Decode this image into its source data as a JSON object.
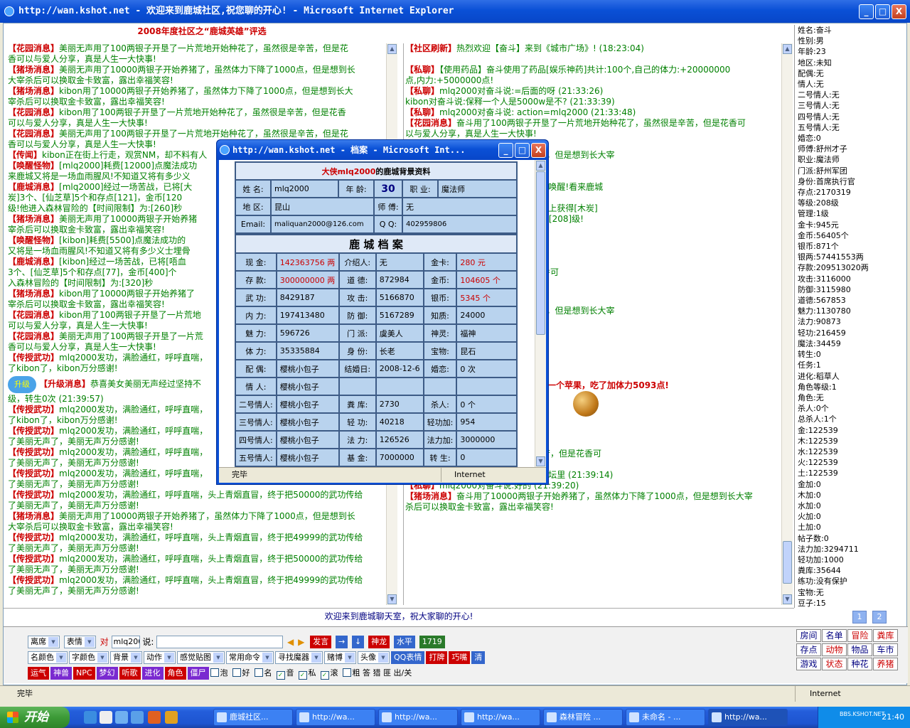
{
  "window": {
    "title": "http://wan.kshot.net - 欢迎来到鹿城社区,祝您聊的开心! - Microsoft Internet Explorer",
    "min": "_",
    "max": "□",
    "close": "X"
  },
  "banner": "2008年度社区之“鹿城英雄”评选",
  "left_chat": [
    {
      "tag": "【花园消息】",
      "text": "美丽无声用了100两银子开垦了一片荒地开始种花了，虽然很是辛苦，但是花"
    },
    {
      "tag": "",
      "text": "香可以与爱人分享，真是人生一大快事!"
    },
    {
      "tag": "【猪场消息】",
      "text": "美丽无声用了10000两银子开始养猪了，虽然体力下降了1000点，但是想到长"
    },
    {
      "tag": "",
      "text": "大宰杀后可以换取金卡致富，露出幸福笑容!"
    },
    {
      "tag": "【猪场消息】",
      "text": "kibon用了10000两银子开始养猪了，虽然体力下降了1000点，但是想到长大"
    },
    {
      "tag": "",
      "text": "宰杀后可以换取金卡致富，露出幸福笑容!"
    },
    {
      "tag": "【花园消息】",
      "text": "kibon用了100两银子开垦了一片荒地开始种花了，虽然很是辛苦，但是花香"
    },
    {
      "tag": "",
      "text": "可以与爱人分享，真是人生一大快事!"
    },
    {
      "tag": "【花园消息】",
      "text": "美丽无声用了100两银子开垦了一片荒地开始种花了，虽然很是辛苦，但是花"
    },
    {
      "tag": "",
      "text": "香可以与爱人分享，真是人生一大快事!"
    },
    {
      "tag": "【传闻】",
      "text": "kibon正在街上行走，观赏NM，却不料有人"
    },
    {
      "tag": "【唤醒怪物】",
      "text": "[mlq2000]耗费[12000]点魔法成功"
    },
    {
      "tag": "",
      "text": "来鹿城又将是一场血雨腥风!不知道又将有多少义"
    },
    {
      "tag": "【鹿城消息】",
      "text": "[mlq2000]经过一场苦战，已将[大"
    },
    {
      "tag": "",
      "text": "炭]3个、[仙芝草]5个和存点[121]，金币[120"
    },
    {
      "tag": "",
      "text": "级!他进入森林冒险的【时间限制】为:[260]秒"
    },
    {
      "tag": "【猪场消息】",
      "text": "美丽无声用了10000两银子开始养猪"
    },
    {
      "tag": "",
      "text": "宰杀后可以换取金卡致富，露出幸福笑容!"
    },
    {
      "tag": "【唤醒怪物】",
      "text": "[kibon]耗费[5500]点魔法成功的"
    },
    {
      "tag": "",
      "text": "又将是一场血雨腥风!不知道又将有多少义士埋骨"
    },
    {
      "tag": "【鹿城消息】",
      "text": "[kibon]经过一场苦战，已将[唔血"
    },
    {
      "tag": "",
      "text": "3个、[仙芝草]5个和存点[77]，金币[400]个"
    },
    {
      "tag": "",
      "text": "入森林冒险的【时间限制】为:[320]秒"
    },
    {
      "tag": "【猪场消息】",
      "text": "kibon用了10000两银子开始养猪了"
    },
    {
      "tag": "",
      "text": "宰杀后可以换取金卡致富，露出幸福笑容!"
    },
    {
      "tag": "【花园消息】",
      "text": "kibon用了100两银子开垦了一片荒地"
    },
    {
      "tag": "",
      "text": "可以与爱人分享，真是人生一大快事!"
    },
    {
      "tag": "【花园消息】",
      "text": "美丽无声用了100两银子开垦了一片荒"
    },
    {
      "tag": "",
      "text": "香可以与爱人分享，真是人生一大快事!"
    },
    {
      "tag": "【传授武功】",
      "text": "mlq2000发功，满脸通红，呼呼直喘，"
    },
    {
      "tag": "",
      "text": "了kibon了，kibon万分感谢!"
    }
  ],
  "left_chat_lower": [
    {
      "tag": "",
      "text": "级，转生0次 (21:39:57)"
    },
    {
      "tag": "【传授武功】",
      "text": "mlq2000发功，满脸通红，呼呼直喘，"
    },
    {
      "tag": "",
      "text": "了kibon了，kibon万分感谢!"
    },
    {
      "tag": "【传授武功】",
      "text": "mlq2000发功，满脸通红，呼呼直喘，"
    },
    {
      "tag": "",
      "text": "了美丽无声了，美丽无声万分感谢!"
    },
    {
      "tag": "【传授武功】",
      "text": "mlq2000发功，满脸通红，呼呼直喘，"
    },
    {
      "tag": "",
      "text": "了美丽无声了，美丽无声万分感谢!"
    },
    {
      "tag": "【传授武功】",
      "text": "mlq2000发功，满脸通红，呼呼直喘，"
    },
    {
      "tag": "",
      "text": "了美丽无声了，美丽无声万分感谢!"
    },
    {
      "tag": "【传授武功】",
      "text": "mlq2000发功，满脸通红，呼呼直喘，头上青烟直冒，终于把50000的武功传给"
    },
    {
      "tag": "",
      "text": "了美丽无声了，美丽无声万分感谢!"
    },
    {
      "tag": "【猪场消息】",
      "text": "美丽无声用了10000两银子开始养猪了，虽然体力下降了1000点，但是想到长"
    },
    {
      "tag": "",
      "text": "大宰杀后可以换取金卡致富，露出幸福笑容!"
    },
    {
      "tag": "【传授武功】",
      "text": "mlq2000发功，满脸通红，呼呼直喘，头上青烟直冒，终于把49999的武功传给"
    },
    {
      "tag": "",
      "text": "了美丽无声了，美丽无声万分感谢!"
    },
    {
      "tag": "【传授武功】",
      "text": "mlq2000发功，满脸通红，呼呼直喘，头上青烟直冒，终于把50000的武功传给"
    },
    {
      "tag": "",
      "text": "了美丽无声了，美丽无声万分感谢!"
    },
    {
      "tag": "【传授武功】",
      "text": "mlq2000发功，满脸通红，呼呼直喘，头上青烟直冒，终于把49999的武功传给"
    },
    {
      "tag": "",
      "text": "了美丽无声了，美丽无声万分感谢!"
    }
  ],
  "upgrade_msg": {
    "badge": "升级",
    "tag": "【升级消息】",
    "text": "恭喜美女美丽无声经过坚持不"
  },
  "right_chat": [
    {
      "tag": "【社区刷新】",
      "text": "热烈欢迎【奋斗】来到《城市广场》! (18:23:04)"
    },
    {
      "tag": "",
      "text": ""
    },
    {
      "tag": "【私聊】",
      "text": "【使用药品】奋斗使用了药品[娱乐神药]共计:100个,自己的体力:+20000000"
    },
    {
      "tag": "",
      "text": "点,内力:+5000000点!"
    },
    {
      "tag": "【私聊】",
      "text": "mlq2000对奋斗说:=后面的呀 (21:33:26)"
    },
    {
      "tag": "",
      "text": "kibon对奋斗说:保释一个人是5000w是不? (21:33:39)"
    },
    {
      "tag": "【私聊】",
      "text": "mlq2000对奋斗说: action=mlq2000 (21:33:48)"
    },
    {
      "tag": "【花园消息】",
      "text": "奋斗用了100两银子开垦了一片荒地开始种花了，虽然很是辛苦，但是花香可"
    },
    {
      "tag": "",
      "text": "以与爱人分享，真是人生一大快事!"
    },
    {
      "tag": "",
      "text": "的改成夜牛狼 (21:34:10)"
    },
    {
      "tag": "",
      "text": "开始养猪了，虽然体力下降了1000点，但是想到长大宰"
    },
    {
      "tag": "",
      "text": "福笑容!"
    },
    {
      "tag": "",
      "text": "到，什么啊 (21:35:06)"
    },
    {
      "tag": "",
      "text": "点魔法成功的将已经死亡的[大眼护卫]唤醒!看来鹿城"
    },
    {
      "tag": "",
      "text": "多少义士埋骨荒野。。。"
    },
    {
      "tag": "",
      "text": "，已将[大眼护卫]消灭，并且从怪物身上获得[木炭]"
    },
    {
      "tag": "",
      "text": "，金币[1200]个! [奋斗]的【等级】为[208]级!"
    },
    {
      "tag": "",
      "text": "[320]秒"
    },
    {
      "tag": "",
      "text": "会看我的信息 (21:35:26)"
    },
    {
      "tag": "",
      "text": "(21:36:04)"
    },
    {
      "tag": "",
      "text": "改成夜牛狼就可以了 (21:36:20)"
    },
    {
      "tag": "",
      "text": "开始种花了，虽然很是辛苦，但是花香可"
    }
  ],
  "right_chat_lower": [
    {
      "tag": "",
      "text": "(21:36:44)"
    },
    {
      "tag": "",
      "text": "开始养猪了，虽然体力下降了1000点，但是想到长大宰"
    },
    {
      "tag": "",
      "text": "福笑容!"
    },
    {
      "tag": "",
      "text": "栏里改 (21:37:29)"
    },
    {
      "tag": "",
      "text": "址栏不行啊 (21:37:52)"
    },
    {
      "tag": "",
      "text": "给你看看 (21:37:59)"
    },
    {
      "tag": "",
      "text": "(21:38:01)"
    },
    {
      "tag": "",
      "text": "(21:38:13)"
    }
  ],
  "apple_msg": "一个苹果，吃了加体力5093点!",
  "right_chat_bottom": [
    {
      "tag": "",
      "text": "改网址啊 (21:38:20)"
    },
    {
      "tag": "",
      "text": "(21:38:46)"
    },
    {
      "tag": "",
      "text": "了qq (21:38:56)"
    },
    {
      "tag": "",
      "text": "了一片荒地开始种花了，虽然很是辛苦，但是花香可"
    },
    {
      "tag": "",
      "text": "以与爱人分享，真是人生一大快事!"
    },
    {
      "tag": "【私聊】",
      "text": "奋斗对mlq2000说:我发到论坛里 (21:39:14)"
    },
    {
      "tag": "【私聊】",
      "text": "mlq2000对奋斗说:好的 (21:39:20)"
    },
    {
      "tag": "【猪场消息】",
      "text": "奋斗用了10000两银子开始养猪了，虽然体力下降了1000点，但是想到长大宰"
    },
    {
      "tag": "",
      "text": "杀后可以换取金卡致富，露出幸福笑容!"
    }
  ],
  "profile": [
    "姓名:奋斗",
    "性别:男",
    "年龄:23",
    "地区:未知",
    "配偶:无",
    "情人:无",
    "二号情人:无",
    "三号情人:无",
    "四号情人:无",
    "五号情人:无",
    "婚恋:0",
    "师傅:舒州才子",
    "职业:魔法师",
    "门派:舒州军团",
    "身份:首席执行官",
    "存点:2170319",
    "等级:208级",
    "管理:1级",
    "金卡:945元",
    "金币:56405个",
    "银币:871个",
    "银两:57441553两",
    "存款:209513020两",
    "攻击:3116000",
    "防御:3115980",
    "道德:567853",
    "魅力:1130780",
    "法力:90873",
    "轻功:216459",
    "魔法:34459",
    "转生:0",
    "任务:1",
    "进化:稻草人",
    "角色等级:1",
    "角色:无",
    "杀人:0个",
    "总杀人:1个",
    "金:122539",
    "木:122539",
    "水:122539",
    "火:122539",
    "土:122539",
    "金加:0",
    "木加:0",
    "水加:0",
    "火加:0",
    "土加:0",
    "帖子数:0",
    "法力加:3294711",
    "轻功加:1000",
    "粪库:35644",
    "练功:没有保护",
    "宝物:无",
    "豆子:15",
    "豆点:803/1000",
    "体力:34428169",
    "内力:210268639",
    "武功:16719643"
  ],
  "welcome": "欢迎来到鹿城聊天室，祝大家聊的开心!",
  "pages": [
    "1",
    "2"
  ],
  "toolbar": {
    "row1_selects": [
      "离席",
      "表情"
    ],
    "to_label": "对",
    "to_value": "mlq2000",
    "say_label": "说:",
    "send": "发言",
    "btn_arrow1": "→",
    "btn_arrow2": "↓",
    "shenlong": "神龙",
    "shuiping": "水平",
    "count": "1719",
    "row2_selects": [
      "名颜色",
      "字颜色",
      "背景",
      "动作",
      "感觉贴图",
      "常用命令",
      "寻找魔器",
      "赌博",
      "头像"
    ],
    "qq": "QQ表情",
    "dapai": "打牌",
    "qiaozui": "巧嘴",
    "qing": "清",
    "row3_btns": [
      "运气",
      "神兽",
      "NPC",
      "梦幻",
      "听歌",
      "进化",
      "角色",
      "僵尸"
    ],
    "checks": [
      {
        "label": "泡",
        "on": false
      },
      {
        "label": "好",
        "on": false
      },
      {
        "label": "名",
        "on": false
      },
      {
        "label": "音",
        "on": true
      },
      {
        "label": "私",
        "on": true
      },
      {
        "label": "滚",
        "on": true
      },
      {
        "label": "粗 答 猎 匪 出/关",
        "on": false
      }
    ]
  },
  "rmenu": [
    {
      "t": "房间",
      "red": false
    },
    {
      "t": "名单",
      "red": false
    },
    {
      "t": "冒险",
      "red": true
    },
    {
      "t": "粪库",
      "red": true
    },
    {
      "t": "存点",
      "red": false
    },
    {
      "t": "动物",
      "red": true
    },
    {
      "t": "物品",
      "red": false
    },
    {
      "t": "车市",
      "red": false
    },
    {
      "t": "游戏",
      "red": false
    },
    {
      "t": "状态",
      "red": true
    },
    {
      "t": "种花",
      "red": false
    },
    {
      "t": "养猪",
      "red": true
    }
  ],
  "statusbar": {
    "text": "完毕",
    "zone": "Internet"
  },
  "taskbar": {
    "start": "开始",
    "tasks": [
      "鹿城社区...",
      "http://wa...",
      "http://wa...",
      "http://wa...",
      "森林冒险 ...",
      "未命名 - ...",
      "http://wa..."
    ],
    "clock": "21:40",
    "url": "BBS.KSHOT.NET"
  },
  "popup": {
    "title": "http://wan.kshot.net - 档案 - Microsoft Int...",
    "heading_name": "大侠mlq2000",
    "heading_rest": "的鹿城背景资料",
    "name_k": "姓 名:",
    "name_v": "mlq2000",
    "age_k": "年 龄:",
    "age_v": "30",
    "job_k": "职 业:",
    "job_v": "魔法师",
    "region_k": "地 区:",
    "region_v": "昆山",
    "master_k": "师 傅:",
    "master_v": "无",
    "email_k": "Email:",
    "email_v": "maliquan2000@126.com",
    "qq_k": "Q Q:",
    "qq_v": "402959806",
    "archive": "鹿 城 档 案",
    "rows": [
      [
        "现 金:",
        "142363756 两",
        "介绍人:",
        "无",
        "金卡:",
        "280 元"
      ],
      [
        "存 款:",
        "300000000 两",
        "道 德:",
        "872984",
        "金币:",
        "104605 个"
      ],
      [
        "武 功:",
        "8429187",
        "攻 击:",
        "5166870",
        "银币:",
        "5345 个"
      ],
      [
        "内 力:",
        "197413480",
        "防 御:",
        "5167289",
        "知质:",
        "24000",
        ""
      ],
      [
        "魅 力:",
        "596726",
        "门 派:",
        "虞美人",
        "神灵:",
        "福神"
      ],
      [
        "体 力:",
        "35335884",
        "身 份:",
        "长老",
        "宝物:",
        "昆石"
      ],
      [
        "配 偶:",
        "樱桃小包子",
        "结婚日:",
        "2008-12-6",
        "婚恋:",
        "0 次"
      ],
      [
        "情 人:",
        "樱桃小包子",
        "",
        "",
        "",
        ""
      ],
      [
        "二号情人:",
        "樱桃小包子",
        "粪 库:",
        "2730",
        "杀人:",
        "0 个"
      ],
      [
        "三号情人:",
        "樱桃小包子",
        "轻 功:",
        "40218",
        "轻功加:",
        "954"
      ],
      [
        "四号情人:",
        "樱桃小包子",
        "法 力:",
        "126526",
        "法力加:",
        "3000000"
      ],
      [
        "五号情人:",
        "樱桃小包子",
        "基 金:",
        "7000000",
        "转 生:",
        "0"
      ]
    ],
    "status": "完毕",
    "zone": "Internet"
  }
}
